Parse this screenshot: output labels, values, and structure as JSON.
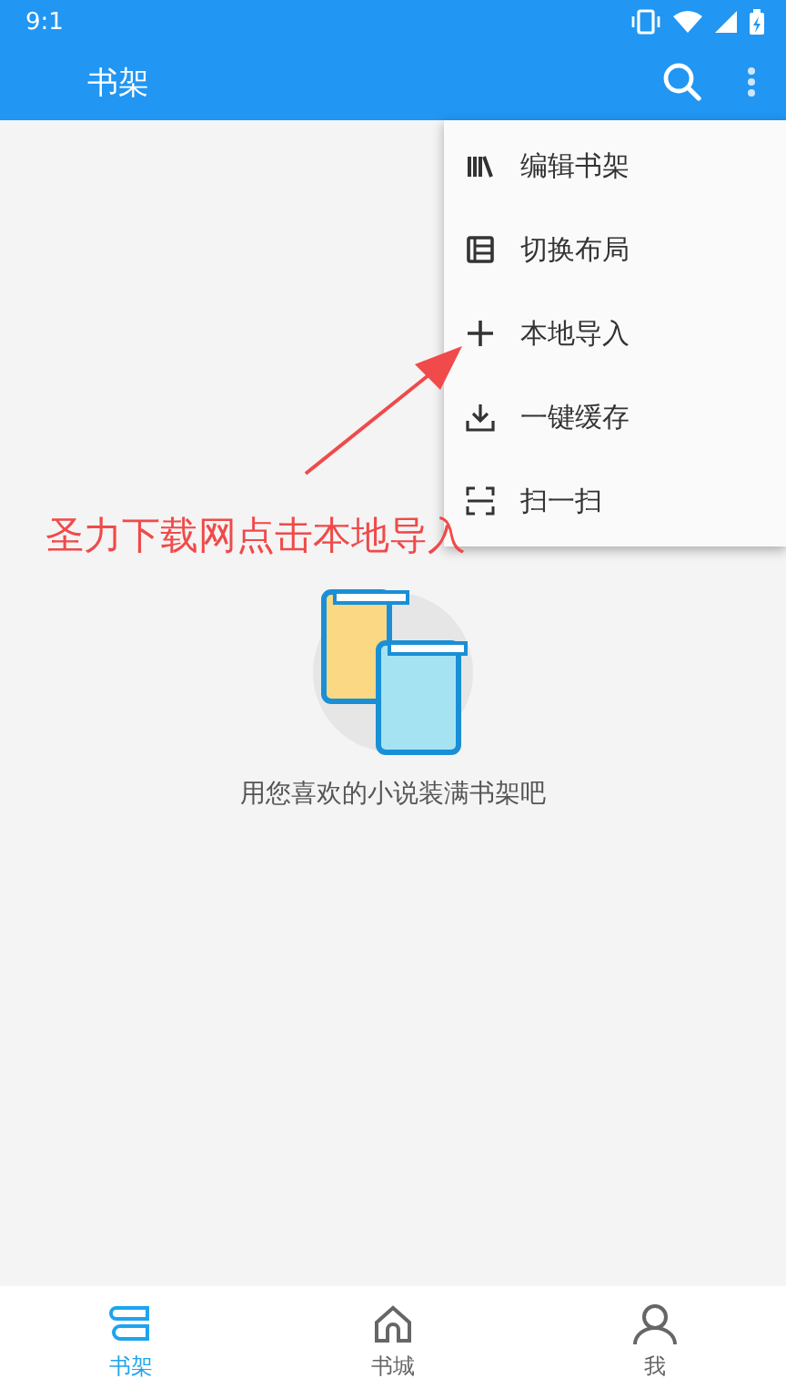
{
  "status_bar": {
    "time": "9:1"
  },
  "toolbar": {
    "title": "书架"
  },
  "menu": {
    "items": [
      {
        "label": "编辑书架",
        "kind": "shelf"
      },
      {
        "label": "切换布局",
        "kind": "layout"
      },
      {
        "label": "本地导入",
        "kind": "add"
      },
      {
        "label": "一键缓存",
        "kind": "download"
      },
      {
        "label": "扫一扫",
        "kind": "scan"
      }
    ]
  },
  "annotation": {
    "text": "圣力下载网点击本地导入"
  },
  "empty_state": {
    "message": "用您喜欢的小说装满书架吧"
  },
  "bottom_nav": [
    {
      "label": "书架",
      "kind": "shelf",
      "selected": true
    },
    {
      "label": "书城",
      "kind": "home",
      "selected": false
    },
    {
      "label": "我",
      "kind": "person",
      "selected": false
    }
  ]
}
